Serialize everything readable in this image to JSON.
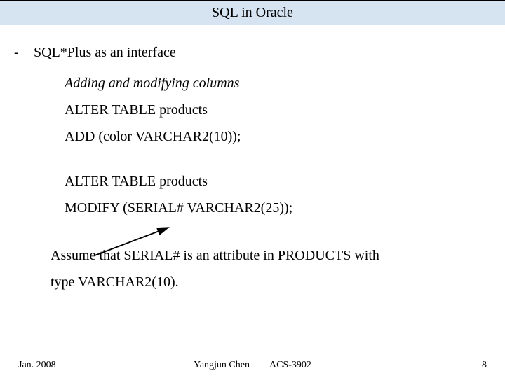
{
  "title": "SQL in Oracle",
  "bullet": "-",
  "heading": "SQL*Plus as an interface",
  "subtitle": "Adding and modifying columns",
  "code1_line1": "ALTER TABLE products",
  "code1_line2": "ADD (color VARCHAR2(10));",
  "code2_line1": "ALTER TABLE products",
  "code2_line2": "MODIFY (SERIAL# VARCHAR2(25));",
  "note_line1": "Assume that SERIAL# is an attribute in PRODUCTS with",
  "note_line2": "type VARCHAR2(10).",
  "footer": {
    "date": "Jan. 2008",
    "author": "Yangjun Chen",
    "course": "ACS-3902",
    "page": "8"
  }
}
